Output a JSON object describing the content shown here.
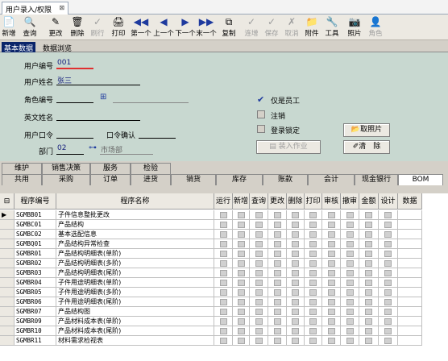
{
  "tab": {
    "title": "用户录入/权限",
    "close": "⊠"
  },
  "toolbar": [
    {
      "name": "new",
      "label": "新增",
      "icon": "📄",
      "enabled": true
    },
    {
      "name": "query",
      "label": "查询",
      "icon": "🔍",
      "enabled": true
    },
    {
      "name": "edit",
      "label": "更改",
      "icon": "✎",
      "enabled": true
    },
    {
      "name": "delete",
      "label": "删除",
      "icon": "🗑",
      "enabled": true
    },
    {
      "name": "refresh",
      "label": "刷行",
      "icon": "✓",
      "enabled": false
    },
    {
      "name": "print",
      "label": "打印",
      "icon": "🖨",
      "enabled": true
    },
    {
      "name": "first",
      "label": "第一个",
      "icon": "◀◀",
      "enabled": true
    },
    {
      "name": "prev",
      "label": "上一个",
      "icon": "◀",
      "enabled": true
    },
    {
      "name": "next",
      "label": "下一个",
      "icon": "▶",
      "enabled": true
    },
    {
      "name": "last",
      "label": "末一个",
      "icon": "▶▶",
      "enabled": true
    },
    {
      "name": "copy",
      "label": "复制",
      "icon": "⧉",
      "enabled": true
    },
    {
      "name": "continue",
      "label": "连增",
      "icon": "✓",
      "enabled": false
    },
    {
      "name": "save",
      "label": "保存",
      "icon": "✓",
      "enabled": false
    },
    {
      "name": "cancel",
      "label": "取消",
      "icon": "✗",
      "enabled": false
    },
    {
      "name": "attach",
      "label": "附件",
      "icon": "📁",
      "enabled": true
    },
    {
      "name": "tools",
      "label": "工具",
      "icon": "🔧",
      "enabled": true
    },
    {
      "name": "photo",
      "label": "照片",
      "icon": "📷",
      "enabled": true
    },
    {
      "name": "role",
      "label": "角色",
      "icon": "👤",
      "enabled": false
    }
  ],
  "panel_tabs": {
    "basic": "基本数据",
    "browse": "数据浏览"
  },
  "form": {
    "user_no_label": "用户编号",
    "user_no": "001",
    "user_name_label": "用户姓名",
    "user_name": "张三",
    "role_no_label": "角色编号",
    "role_no": "",
    "eng_name_label": "英文姓名",
    "eng_name": "",
    "password_label": "用户口令",
    "password": "",
    "confirm_label": "口令确认",
    "confirm": "",
    "dept_label": "部门",
    "dept_code": "02",
    "dept_name": "市场部",
    "employee_only": "仅是员工",
    "employee_only_checked": true,
    "deregister": "注销",
    "deregister_checked": false,
    "login_lock": "登录锁定",
    "login_lock_checked": false,
    "load_job": "装入作业",
    "photo_btn": "取照片",
    "clear_btn": "清　除"
  },
  "categories_row1": [
    "维护",
    "销售决策",
    "服务",
    "检验"
  ],
  "categories_row2": [
    "共用",
    "采购",
    "订单",
    "进货",
    "销货",
    "库存",
    "账款",
    "会计",
    "现金银行",
    "BOM"
  ],
  "grid": {
    "headers": [
      "程序编号",
      "程序名称",
      "运行",
      "新增",
      "查询",
      "更改",
      "删除",
      "打印",
      "审核",
      "撤审",
      "金额",
      "设计",
      "数据"
    ],
    "rows": [
      {
        "code": "SGMBB01",
        "name": "子件信息整批更改"
      },
      {
        "code": "SGMBC01",
        "name": "产品结构"
      },
      {
        "code": "SGMBC02",
        "name": "基本选配信息"
      },
      {
        "code": "SGMBQ01",
        "name": "产品结构异常检查"
      },
      {
        "code": "SGMBR01",
        "name": "产品结构明细表(单阶)"
      },
      {
        "code": "SGMBR02",
        "name": "产品结构明细表(多阶)"
      },
      {
        "code": "SGMBR03",
        "name": "产品结构明细表(尾阶)"
      },
      {
        "code": "SGMBR04",
        "name": "子件用途明细表(单阶)"
      },
      {
        "code": "SGMBR05",
        "name": "子件用途明细表(多阶)"
      },
      {
        "code": "SGMBR06",
        "name": "子件用途明细表(尾阶)"
      },
      {
        "code": "SGMBR07",
        "name": "产品结构图"
      },
      {
        "code": "SGMBR09",
        "name": "产品材料成本表(单阶)"
      },
      {
        "code": "SGMBR10",
        "name": "产品材料成本表(尾阶)"
      },
      {
        "code": "SGMBR11",
        "name": "材料需求检视表"
      }
    ]
  }
}
